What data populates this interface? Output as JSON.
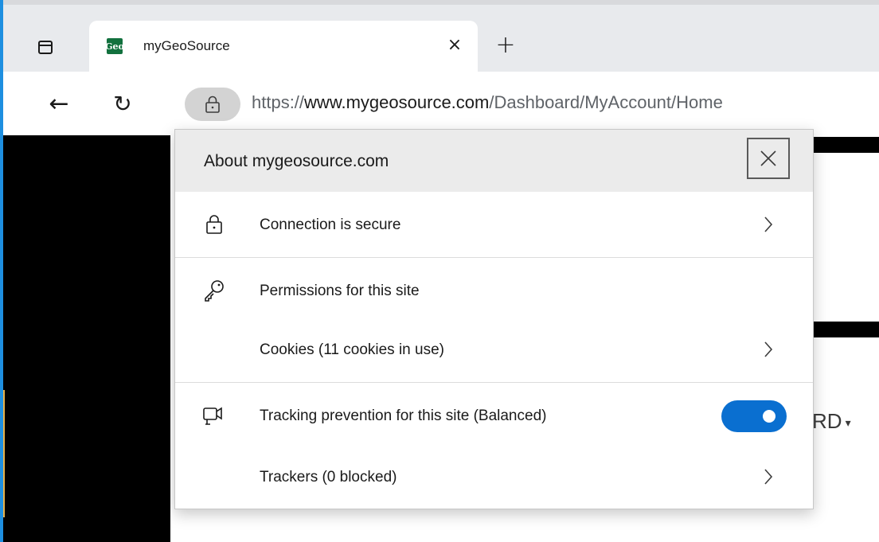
{
  "browser": {
    "tab": {
      "favicon_text": "Geo",
      "title": "myGeoSource",
      "close_glyph": "×"
    },
    "new_tab_glyph": "+",
    "back_glyph": "←",
    "reload_glyph": "↻",
    "address": {
      "url_scheme": "https://",
      "url_host": "www.mygeosource.com",
      "url_path": "/Dashboard/MyAccount/Home"
    }
  },
  "flyout": {
    "title": "About mygeosource.com",
    "connection_label": "Connection is secure",
    "permissions_label": "Permissions for this site",
    "cookies_label": "Cookies (11 cookies in use)",
    "tracking_label": "Tracking prevention for this site (Balanced)",
    "tracking_enabled": true,
    "trackers_label": "Trackers (0 blocked)"
  },
  "page": {
    "nav_label_fragment": "RD",
    "nav_caret": "▾"
  },
  "colors": {
    "accent": "#0a6fd0",
    "favicon_bg": "#12713e",
    "edge_accent": "#1e8fe0"
  },
  "icons": [
    "tab-actions-icon",
    "geo-favicon-icon",
    "close-icon",
    "plus-icon",
    "back-arrow-icon",
    "reload-icon",
    "lock-icon",
    "key-icon",
    "tracking-prevention-icon",
    "chevron-right-icon"
  ]
}
